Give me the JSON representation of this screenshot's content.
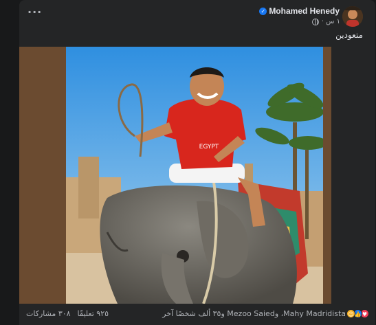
{
  "post": {
    "author": "Mohamed Henedy",
    "time": "١ س ·",
    "caption": "متعودين",
    "more_label": "···"
  },
  "photo": {
    "shirt_text": "EGYPT"
  },
  "footer": {
    "reaction_text": "Mahy Madridista، وMezoo Saied و٣٥ ألف شخصًا آخر",
    "comments": "٩٢٥ تعليقًا",
    "shares": "٣٠٨ مشاركات"
  },
  "colors": {
    "background": "#18191a",
    "card": "#242526",
    "text_primary": "#e4e6eb",
    "text_secondary": "#b0b3b8",
    "brand_blue": "#1877f2"
  },
  "icons": {
    "verified": "verified-badge-icon",
    "privacy": "globe-icon",
    "reactions": [
      "haha-icon",
      "like-icon",
      "love-icon"
    ]
  }
}
